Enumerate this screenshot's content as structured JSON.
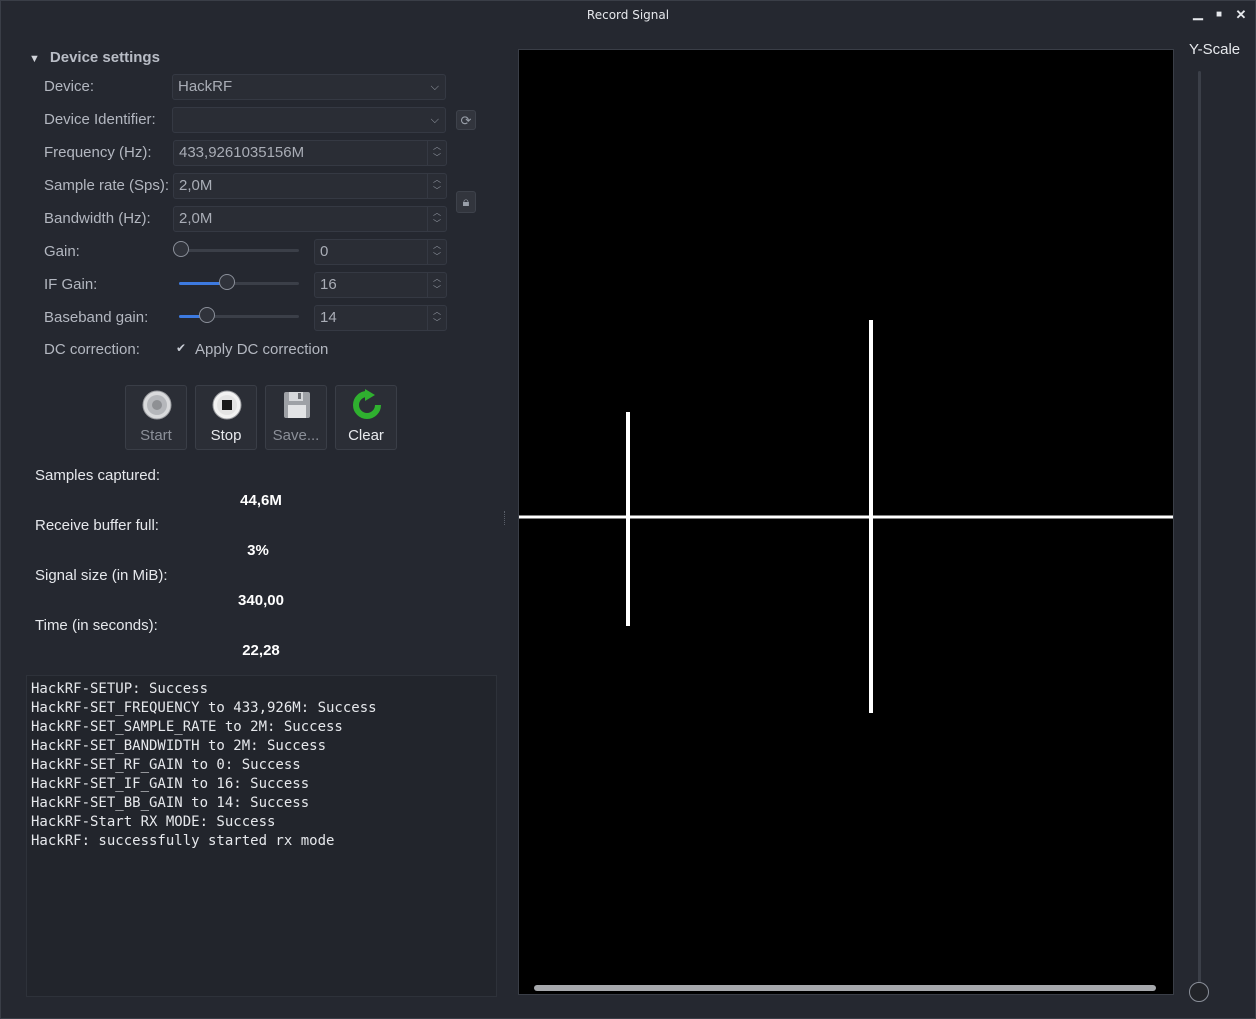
{
  "window": {
    "title": "Record Signal",
    "minimize": "▁",
    "maximize": "■",
    "close": "✕"
  },
  "settings": {
    "header": "Device settings",
    "device_label": "Device:",
    "device_value": "HackRF",
    "device_id_label": "Device Identifier:",
    "device_id_value": "",
    "frequency_label": "Frequency (Hz):",
    "frequency_value": "433,9261035156M",
    "sample_rate_label": "Sample rate (Sps):",
    "sample_rate_value": "2,0M",
    "bandwidth_label": "Bandwidth (Hz):",
    "bandwidth_value": "2,0M",
    "gain_label": "Gain:",
    "gain_value": "0",
    "if_gain_label": "IF Gain:",
    "if_gain_value": "16",
    "bb_gain_label": "Baseband gain:",
    "bb_gain_value": "14",
    "dc_label": "DC correction:",
    "dc_checkbox_label": "Apply DC correction",
    "dc_checked": true
  },
  "toolbar": {
    "start_label": "Start",
    "stop_label": "Stop",
    "save_label": "Save...",
    "clear_label": "Clear"
  },
  "stats": {
    "samples_label": "Samples captured:",
    "samples_value": "44,6M",
    "buffer_label": "Receive buffer full:",
    "buffer_value": "3%",
    "size_label": "Signal size (in MiB):",
    "size_value": "340,00",
    "time_label": "Time (in seconds):",
    "time_value": "22,28"
  },
  "log": {
    "lines": [
      "HackRF-SETUP: Success",
      "HackRF-SET_FREQUENCY to 433,926M: Success",
      "HackRF-SET_SAMPLE_RATE to 2M: Success",
      "HackRF-SET_BANDWIDTH to 2M: Success",
      "HackRF-SET_RF_GAIN to 0: Success",
      "HackRF-SET_IF_GAIN to 16: Success",
      "HackRF-SET_BB_GAIN to 14: Success",
      "HackRF-Start RX MODE: Success",
      "HackRF: successfully started rx mode"
    ]
  },
  "yscale": {
    "label": "Y-Scale"
  },
  "colors": {
    "background": "#252830",
    "graph_bg": "#000000",
    "signal": "#ffffff",
    "accent": "#3d7ae0"
  }
}
